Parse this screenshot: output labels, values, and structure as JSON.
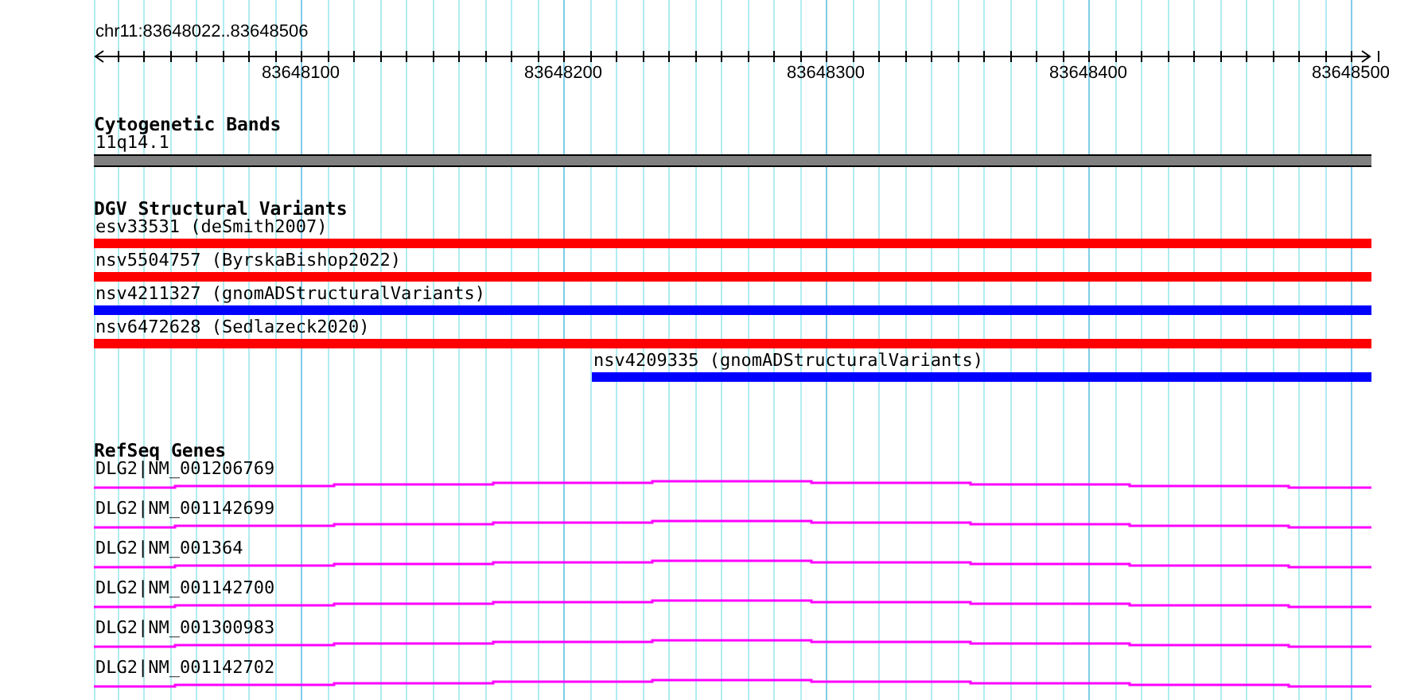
{
  "ruler": {
    "region": "chr11:83648022..83648506",
    "tick_labels": [
      "83648100",
      "83648200",
      "83648300",
      "83648400",
      "83648500"
    ]
  },
  "cytogenetic_bands": {
    "title": "Cytogenetic Bands",
    "band": {
      "label": "11q14.1"
    }
  },
  "dgv_structural_variants": {
    "title": "DGV Structural Variants",
    "features": [
      {
        "label": "esv33531 (deSmith2007)",
        "color": "#ff0000",
        "kind": "full"
      },
      {
        "label": "nsv5504757 (ByrskaBishop2022)",
        "color": "#ff0000",
        "kind": "full"
      },
      {
        "label": "nsv4211327 (gnomADStructuralVariants)",
        "color": "#0000ff",
        "kind": "full"
      },
      {
        "label": "nsv6472628 (Sedlazeck2020)",
        "color": "#ff0000",
        "kind": "full"
      },
      {
        "label": "nsv4209335 (gnomADStructuralVariants)",
        "color": "#0000ff",
        "kind": "partial"
      }
    ]
  },
  "refseq_genes": {
    "title": "RefSeq Genes",
    "transcripts": [
      {
        "label": "DLG2|NM_001206769"
      },
      {
        "label": "DLG2|NM_001142699"
      },
      {
        "label": "DLG2|NM_001364"
      },
      {
        "label": "DLG2|NM_001142700"
      },
      {
        "label": "DLG2|NM_001300983"
      },
      {
        "label": "DLG2|NM_001142702"
      }
    ]
  }
}
